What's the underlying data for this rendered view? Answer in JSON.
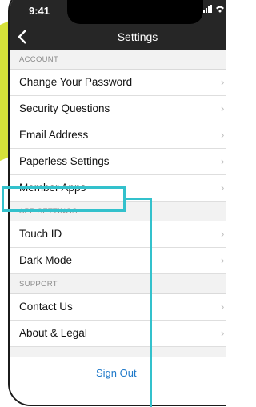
{
  "status_bar": {
    "time": "9:41",
    "icons": "signal-wifi-battery"
  },
  "nav": {
    "title": "Settings",
    "back_icon": "chevron-left"
  },
  "sections": {
    "account": {
      "header": "ACCOUNT",
      "items": [
        "Change Your Password",
        "Security Questions",
        "Email Address",
        "Paperless Settings",
        "Member Apps"
      ]
    },
    "app_settings": {
      "header": "APP SETTINGS",
      "items": [
        "Touch ID",
        "Dark Mode"
      ]
    },
    "support": {
      "header": "SUPPORT",
      "items": [
        "Contact Us",
        "About & Legal"
      ]
    }
  },
  "sign_out": "Sign Out",
  "colors": {
    "accent": "#d6e13a",
    "highlight": "#33c1cc",
    "link": "#1f79c9",
    "navbar": "#262626"
  }
}
